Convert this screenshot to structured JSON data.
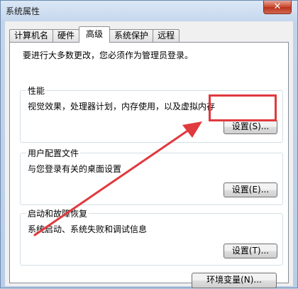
{
  "window": {
    "title": "系统属性",
    "close_label": "✕"
  },
  "tabs": [
    {
      "label": "计算机名"
    },
    {
      "label": "硬件"
    },
    {
      "label": "高级",
      "active": true
    },
    {
      "label": "系统保护"
    },
    {
      "label": "远程"
    }
  ],
  "notice": "要进行大多数更改，您必须作为管理员登录。",
  "performance": {
    "title": "性能",
    "description": "视觉效果，处理器计划，内存使用，以及虚拟内存",
    "button": "设置(S)..."
  },
  "user_profiles": {
    "title": "用户配置文件",
    "description": "与您登录有关的桌面设置",
    "button": "设置(E)..."
  },
  "startup_recovery": {
    "title": "启动和故障恢复",
    "description": "系统启动、系统失败和调试信息",
    "button": "设置(T)..."
  },
  "env_button": "环境变量(N)...",
  "annotation_color": "#e0393e"
}
